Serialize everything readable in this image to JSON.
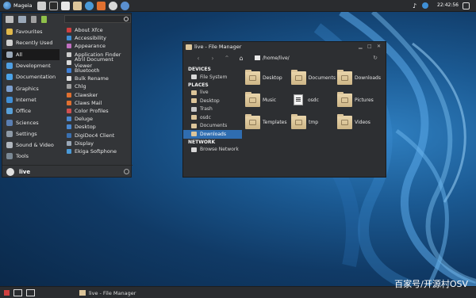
{
  "top_panel": {
    "start_label": "Mageia",
    "clock": "22:42:56",
    "launchers": [
      "desktop-icon",
      "terminal-icon",
      "text-editor-icon",
      "files-icon",
      "web-browser-icon",
      "mail-icon",
      "firefox-icon",
      "settings-icon"
    ]
  },
  "app_menu": {
    "categories": [
      {
        "label": "Favourites",
        "icon": "star-icon",
        "color": "#e0b84a"
      },
      {
        "label": "Recently Used",
        "icon": "clock-icon",
        "color": "#cfcfcf"
      },
      {
        "label": "All",
        "icon": "grid-icon",
        "color": "#9aa8b8",
        "selected": true
      },
      {
        "label": "Development",
        "icon": "development-icon",
        "color": "#4e9fe3"
      },
      {
        "label": "Documentation",
        "icon": "help-icon",
        "color": "#4aa3e8"
      },
      {
        "label": "Graphics",
        "icon": "graphics-icon",
        "color": "#7b9fcf"
      },
      {
        "label": "Internet",
        "icon": "globe-icon",
        "color": "#3f8fd6"
      },
      {
        "label": "Office",
        "icon": "office-icon",
        "color": "#58a0d8"
      },
      {
        "label": "Sciences",
        "icon": "sciences-icon",
        "color": "#5a7fb3"
      },
      {
        "label": "Settings",
        "icon": "settings-icon",
        "color": "#8d99a6"
      },
      {
        "label": "Sound & Video",
        "icon": "multimedia-icon",
        "color": "#b0b6bd"
      },
      {
        "label": "Tools",
        "icon": "tools-icon",
        "color": "#7a8894"
      }
    ],
    "items": [
      {
        "label": "About Xfce",
        "color": "#d04040"
      },
      {
        "label": "Accessibility",
        "color": "#3f8fd6"
      },
      {
        "label": "Appearance",
        "color": "#c070c0"
      },
      {
        "label": "Application Finder",
        "color": "#cfcfcf"
      },
      {
        "label": "Atril Document Viewer",
        "color": "#d9d9d9"
      },
      {
        "label": "Bluetooth",
        "color": "#3f7fd6"
      },
      {
        "label": "Bulk Rename",
        "color": "#e0e0e0"
      },
      {
        "label": "Chlg",
        "color": "#a0a0a0"
      },
      {
        "label": "Clawsker",
        "color": "#e07030"
      },
      {
        "label": "Claws Mail",
        "color": "#e07030"
      },
      {
        "label": "Color Profiles",
        "color": "#d05050"
      },
      {
        "label": "Deluge",
        "color": "#4a88d0"
      },
      {
        "label": "Desktop",
        "color": "#4a88d0"
      },
      {
        "label": "DigiDoc4 Client",
        "color": "#3a70b0"
      },
      {
        "label": "Display",
        "color": "#9aa8b8"
      },
      {
        "label": "Ekiga Softphone",
        "color": "#4a9ad8"
      }
    ],
    "user": "live"
  },
  "file_manager": {
    "title": "live - File Manager",
    "path": "/home/live/",
    "sections": {
      "devices": "DEVICES",
      "places": "PLACES",
      "network": "NETWORK"
    },
    "devices": [
      {
        "label": "File System",
        "icon": "drive-icon",
        "color": "#d8d8d8"
      }
    ],
    "places": [
      {
        "label": "live",
        "icon": "home-folder-icon",
        "color": "#dcc59a"
      },
      {
        "label": "Desktop",
        "icon": "desktop-folder-icon",
        "color": "#dcc59a"
      },
      {
        "label": "Trash",
        "icon": "trash-icon",
        "color": "#c8c8c8"
      },
      {
        "label": "osdc",
        "icon": "folder-icon",
        "color": "#dcc59a"
      },
      {
        "label": "Documents",
        "icon": "documents-folder-icon",
        "color": "#dcc59a"
      },
      {
        "label": "Downloads",
        "icon": "downloads-folder-icon",
        "color": "#dcc59a",
        "selected": true
      }
    ],
    "network": [
      {
        "label": "Browse Network",
        "icon": "network-icon",
        "color": "#d8d8d8"
      }
    ],
    "files": [
      {
        "label": "Desktop",
        "kind": "folder"
      },
      {
        "label": "Documents",
        "kind": "folder"
      },
      {
        "label": "Downloads",
        "kind": "folder"
      },
      {
        "label": "Music",
        "kind": "folder"
      },
      {
        "label": "osdc",
        "kind": "document"
      },
      {
        "label": "Pictures",
        "kind": "folder"
      },
      {
        "label": "Templates",
        "kind": "folder"
      },
      {
        "label": "tmp",
        "kind": "folder"
      },
      {
        "label": "Videos",
        "kind": "folder"
      }
    ]
  },
  "taskbar": {
    "task_label": "live - File Manager"
  },
  "watermark": "百家号/开源村OSV"
}
